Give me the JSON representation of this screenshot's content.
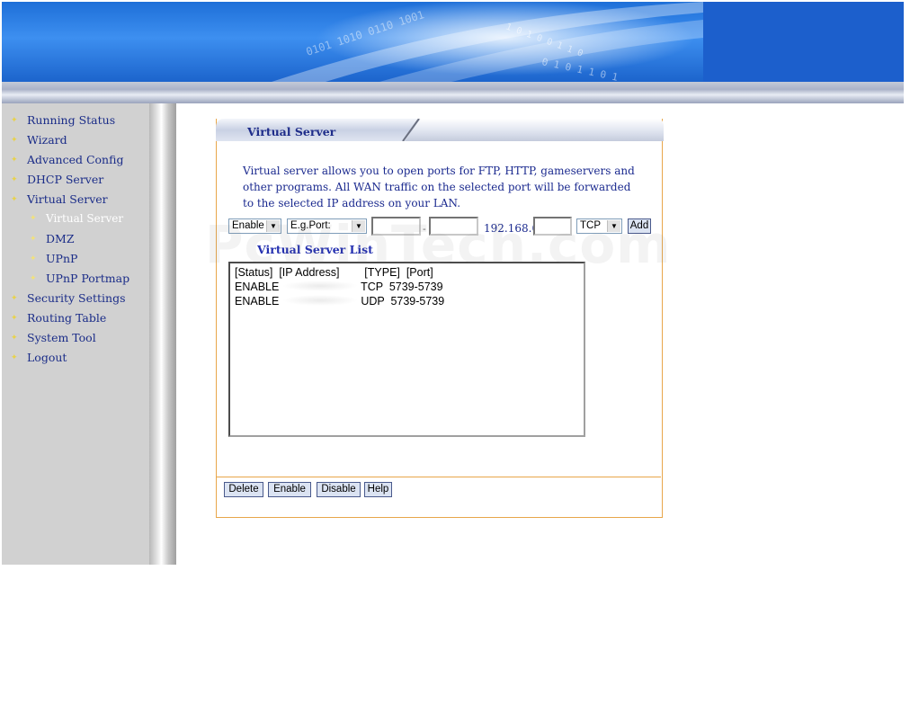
{
  "colors": {
    "accent_border": "#e8a64a",
    "nav_text": "#1a2c88",
    "sidebar_bg": "#d1d1d1",
    "title_text": "#1f2d8a"
  },
  "nav": {
    "items": [
      {
        "label": "Running Status"
      },
      {
        "label": "Wizard"
      },
      {
        "label": "Advanced Config"
      },
      {
        "label": "DHCP Server"
      },
      {
        "label": "Virtual Server"
      },
      {
        "label": "Virtual Server"
      },
      {
        "label": "DMZ"
      },
      {
        "label": "UPnP"
      },
      {
        "label": "UPnP Portmap"
      },
      {
        "label": "Security Settings"
      },
      {
        "label": "Routing Table"
      },
      {
        "label": "System Tool"
      },
      {
        "label": "Logout"
      }
    ]
  },
  "panel": {
    "title": "Virtual Server",
    "description": "Virtual server allows you to open ports for FTP, HTTP, gameservers and other programs. All WAN traffic on the selected port will be forwarded to the selected IP address on your LAN."
  },
  "form": {
    "status_select": "Enable",
    "port_select": "E.g.Port:",
    "port_start": "",
    "port_end": "",
    "port_separator": "-",
    "ip_prefix": "192.168.0.",
    "ip_last": "",
    "type_select": "TCP",
    "add_label": "Add"
  },
  "list": {
    "title": "Virtual Server List",
    "header": "[Status]  [IP Address]        [TYPE]  [Port]",
    "rows": [
      {
        "status": "ENABLE",
        "type": "TCP",
        "port": "5739-5739"
      },
      {
        "status": "ENABLE",
        "type": "UDP",
        "port": "5739-5739"
      }
    ]
  },
  "buttons": {
    "delete": "Delete",
    "enable": "Enable",
    "disable": "Disable",
    "help": "Help"
  },
  "watermark": "PcWinTech.com"
}
